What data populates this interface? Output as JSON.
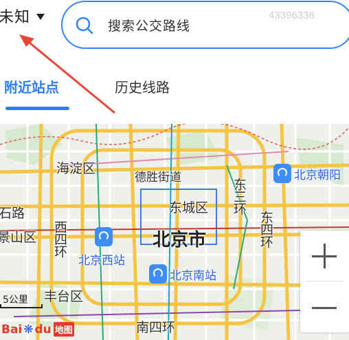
{
  "header": {
    "city": "未知",
    "search_placeholder": "搜索公交路线",
    "watermark": "43396336"
  },
  "tabs": [
    {
      "label": "附近站点",
      "active": true
    },
    {
      "label": "历史线路",
      "active": false
    }
  ],
  "map": {
    "districts": {
      "haidian": "海淀区",
      "dongcheng": "东城区",
      "fengtai": "丰台区",
      "shijingshan_partial": "景山区",
      "city": "北京市"
    },
    "roads": {
      "deshengjie": "德胜街道",
      "shilu": "石路",
      "west4": "西四环",
      "east3": "东三环",
      "east4": "东四环",
      "south4": "南四环"
    },
    "stations": [
      {
        "name": "北京朝阳"
      },
      {
        "name": "北京西站"
      },
      {
        "name": "北京南站"
      }
    ],
    "scale": "5公里",
    "logo": {
      "text_a": "Bai",
      "text_b": "du",
      "map_word": "地图"
    },
    "colors": {
      "accent": "#3385ff",
      "station": "#3f8cf5",
      "arrow": "#e8463a"
    }
  },
  "icons": [
    "search-icon",
    "dropdown-caret-icon",
    "station-icon",
    "plus-icon",
    "minus-icon",
    "paw-icon"
  ]
}
